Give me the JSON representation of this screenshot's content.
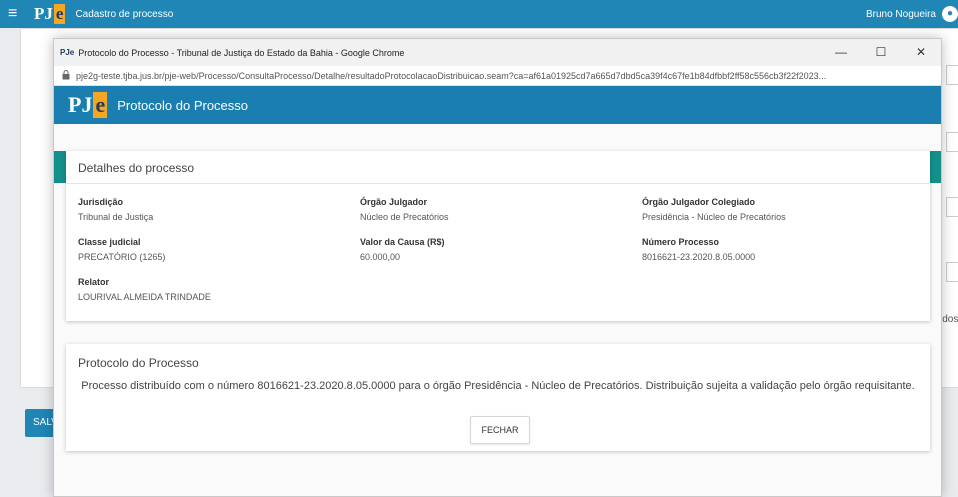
{
  "app": {
    "logo_pj": "PJ",
    "logo_e": "e",
    "title": "Cadastro de processo",
    "user_name": "Bruno Nogueira",
    "user_icon": "user-icon",
    "bg_button_label": "SALV",
    "bg_right_text": "idos"
  },
  "browser": {
    "favicon": "PJe",
    "window_title": "Protocolo do Processo - Tribunal de Justiça do Estado da Bahia - Google Chrome",
    "minimize": "—",
    "maximize": "☐",
    "close": "✕",
    "lock_icon": "🔒",
    "url": "pje2g-teste.tjba.jus.br/pje-web/Processo/ConsultaProcesso/Detalhe/resultadoProtocolacaoDistribuicao.seam?ca=af61a01925cd7a665d7dbd5ca39f4c67fe1b84dfbbf2ff58c556cb3f22f2023..."
  },
  "pje": {
    "logo_pj": "PJ",
    "logo_e": "e",
    "header_title": "Protocolo do Processo"
  },
  "details": {
    "title": "Detalhes do processo",
    "fields": [
      {
        "label": "Jurisdição",
        "value": "Tribunal de Justiça"
      },
      {
        "label": "Órgão Julgador",
        "value": "Núcleo de Precatórios"
      },
      {
        "label": "Órgão Julgador Colegiado",
        "value": "Presidência - Núcleo de Precatórios"
      },
      {
        "label": "Classe judicial",
        "value": "PRECATÓRIO (1265)"
      },
      {
        "label": "Valor da Causa (R$)",
        "value": "60.000,00"
      },
      {
        "label": "Número Processo",
        "value": "8016621-23.2020.8.05.0000"
      },
      {
        "label": "Relator",
        "value": "LOURIVAL ALMEIDA TRINDADE"
      }
    ]
  },
  "protocol": {
    "title": "Protocolo do Processo",
    "message": "Processo distribuído com o número 8016621-23.2020.8.05.0000 para o órgão Presidência - Núcleo de Precatórios. Distribuição sujeita a validação pelo órgão requisitante.",
    "close_button": "FECHAR"
  },
  "colors": {
    "topbar": "#1f86b5",
    "pje_header": "#1a7fb0",
    "teal": "#158f8a",
    "logo_accent": "#f5a623"
  }
}
